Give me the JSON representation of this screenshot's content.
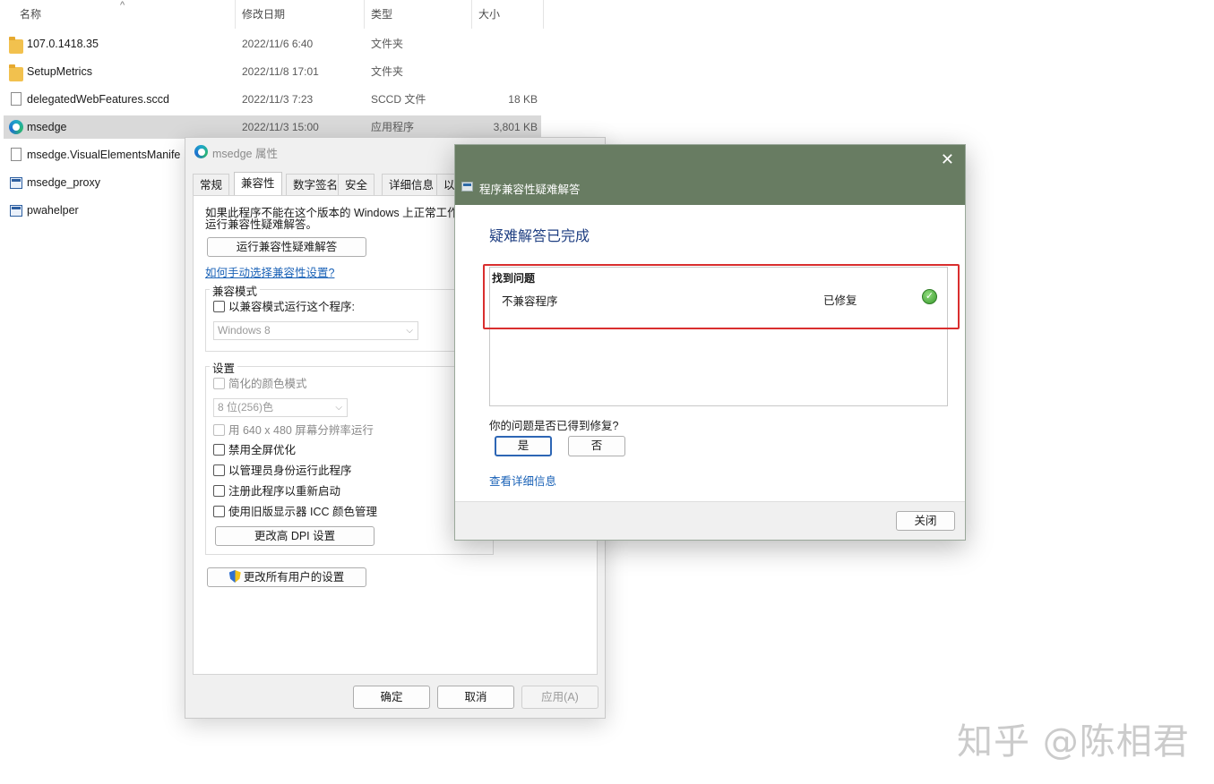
{
  "file_list": {
    "headers": {
      "name": "名称",
      "date": "修改日期",
      "type": "类型",
      "size": "大小"
    },
    "rows": [
      {
        "name": "107.0.1418.35",
        "date": "2022/11/6 6:40",
        "type": "文件夹",
        "size": "",
        "icon": "folder-icon"
      },
      {
        "name": "SetupMetrics",
        "date": "2022/11/8 17:01",
        "type": "文件夹",
        "size": "",
        "icon": "folder-icon"
      },
      {
        "name": "delegatedWebFeatures.sccd",
        "date": "2022/11/3 7:23",
        "type": "SCCD 文件",
        "size": "18 KB",
        "icon": "document-icon"
      },
      {
        "name": "msedge",
        "date": "2022/11/3 15:00",
        "type": "应用程序",
        "size": "3,801 KB",
        "icon": "edge-icon",
        "selected": true
      },
      {
        "name": "msedge.VisualElementsManife",
        "date": "",
        "type": "",
        "size": "",
        "icon": "document-icon"
      },
      {
        "name": "msedge_proxy",
        "date": "",
        "type": "",
        "size": "",
        "icon": "application-icon"
      },
      {
        "name": "pwahelper",
        "date": "",
        "type": "",
        "size": "",
        "icon": "application-icon"
      }
    ]
  },
  "properties": {
    "title": "msedge 属性",
    "tabs": [
      "常规",
      "兼容性",
      "数字签名",
      "安全",
      "详细信息",
      "以前"
    ],
    "active_tab": "兼容性",
    "intro_line1": "如果此程序不能在这个版本的 Windows 上正常工作，",
    "intro_line2": "运行兼容性疑难解答。",
    "run_troubleshooter_button": "运行兼容性疑难解答",
    "manual_link": "如何手动选择兼容性设置?",
    "compat_mode": {
      "group_label": "兼容模式",
      "checkbox_label": "以兼容模式运行这个程序:",
      "os_select": "Windows 8"
    },
    "settings": {
      "group_label": "设置",
      "reduced_color": "简化的颜色模式",
      "color_select": "8 位(256)色",
      "res_640": "用 640 x 480 屏幕分辨率运行",
      "disable_fullscreen": "禁用全屏优化",
      "run_as_admin": "以管理员身份运行此程序",
      "register_restart": "注册此程序以重新启动",
      "legacy_icc": "使用旧版显示器 ICC 颜色管理",
      "dpi_button": "更改高 DPI 设置"
    },
    "all_users_button": "更改所有用户的设置",
    "ok_button": "确定",
    "cancel_button": "取消",
    "apply_button": "应用(A)"
  },
  "troubleshooter": {
    "title": "程序兼容性疑难解答",
    "heading": "疑难解答已完成",
    "found_label": "找到问题",
    "problem_name": "不兼容程序",
    "problem_status": "已修复",
    "question": "你的问题是否已得到修复?",
    "yes_button": "是",
    "no_button": "否",
    "detail_link": "查看详细信息",
    "close_button": "关闭",
    "close_glyph": "✕",
    "highlight_color": "#d92e2e",
    "titlebar_color": "#687c62"
  },
  "watermark": "知乎 @陈相君"
}
